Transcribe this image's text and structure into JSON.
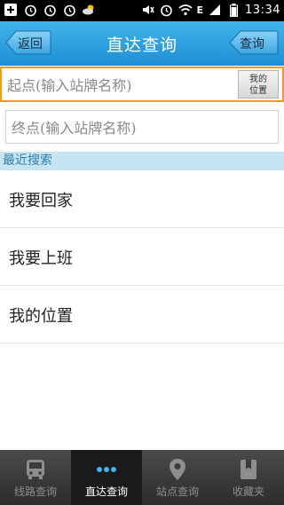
{
  "status_bar": {
    "time": "13:34",
    "network": "E",
    "left_icons": [
      "add-icon",
      "alarm-icon",
      "alarm-icon",
      "alarm-icon",
      "weather-icon"
    ],
    "right_icons": [
      "mute-icon",
      "alarm-icon",
      "wifi-icon",
      "signal-icon",
      "battery-icon"
    ]
  },
  "header": {
    "back_label": "返回",
    "title": "直达查询",
    "query_label": "查询"
  },
  "search": {
    "start_placeholder": "起点(输入站牌名称)",
    "end_placeholder": "终点(输入站牌名称)",
    "my_location_line1": "我的",
    "my_location_line2": "位置"
  },
  "recent": {
    "header": "最近搜索",
    "items": [
      "我要回家",
      "我要上班",
      "我的位置"
    ]
  },
  "tabs": [
    {
      "label": "线路查询",
      "icon": "bus-icon",
      "active": false
    },
    {
      "label": "直达查询",
      "icon": "dots-icon",
      "active": true
    },
    {
      "label": "站点查询",
      "icon": "location-pin-icon",
      "active": false
    },
    {
      "label": "收藏夹",
      "icon": "bookmark-icon",
      "active": false
    }
  ],
  "colors": {
    "titlebar": "#2a9fe0",
    "accent_border": "#f29a1e",
    "recent_header_bg": "#c6e4f2",
    "tabbar": "#3a3a3a"
  }
}
